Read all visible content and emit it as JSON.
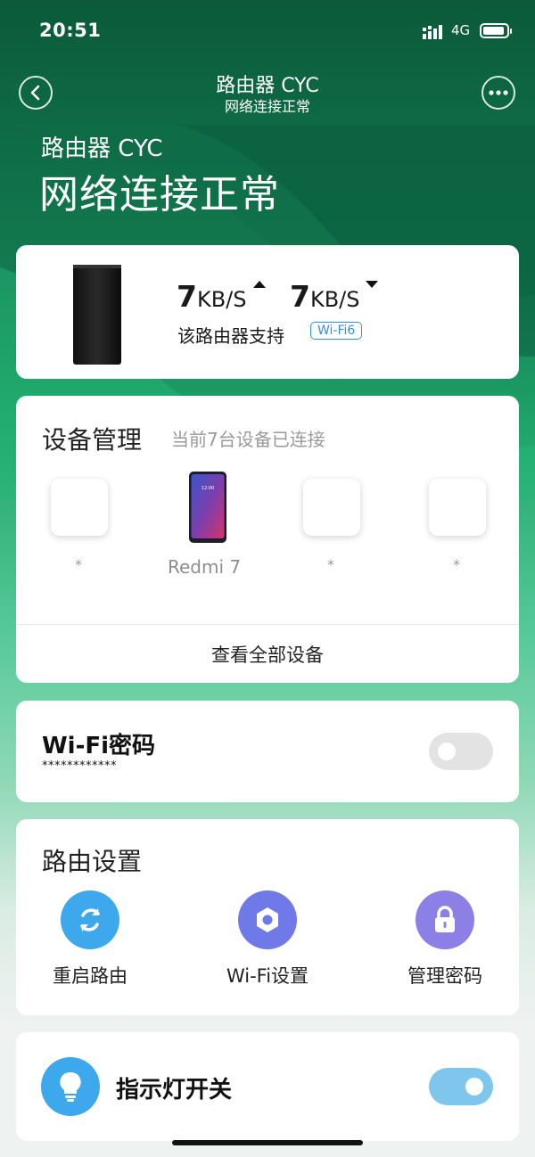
{
  "status_bar": {
    "time": "20:51",
    "network": "4G"
  },
  "nav": {
    "title": "路由器 CYC",
    "subtitle": "网络连接正常"
  },
  "hero": {
    "name": "路由器 CYC",
    "status": "网络连接正常"
  },
  "speed": {
    "upload_value": "7",
    "upload_unit": "KB/S",
    "download_value": "7",
    "download_unit": "KB/S",
    "support_text": "该路由器支持",
    "wifi_badge": "Wi-Fi6"
  },
  "devices": {
    "title": "设备管理",
    "subtitle": "当前7台设备已连接",
    "items": [
      {
        "label": "*",
        "icon": "device-placeholder-icon"
      },
      {
        "label": "Redmi 7",
        "icon": "smartphone-icon"
      },
      {
        "label": "*",
        "icon": "device-placeholder-icon"
      },
      {
        "label": "*",
        "icon": "device-placeholder-icon"
      }
    ],
    "view_all": "查看全部设备"
  },
  "wifi_password": {
    "title": "Wi-Fi密码",
    "masked": "************",
    "toggle_on": false
  },
  "router_settings": {
    "title": "路由设置",
    "items": [
      {
        "label": "重启路由",
        "icon": "restart-icon",
        "color": "#3ea8ec"
      },
      {
        "label": "Wi-Fi设置",
        "icon": "hexagon-settings-icon",
        "color": "#6f7ae8"
      },
      {
        "label": "管理密码",
        "icon": "lock-icon",
        "color": "#8c7fe6"
      }
    ]
  },
  "indicator_light": {
    "title": "指示灯开关",
    "icon": "lightbulb-icon",
    "toggle_on": true
  },
  "colors": {
    "accent_blue": "#3ea8ec",
    "badge_blue": "#2f8fe0",
    "toggle_on": "#7fc6ec"
  }
}
